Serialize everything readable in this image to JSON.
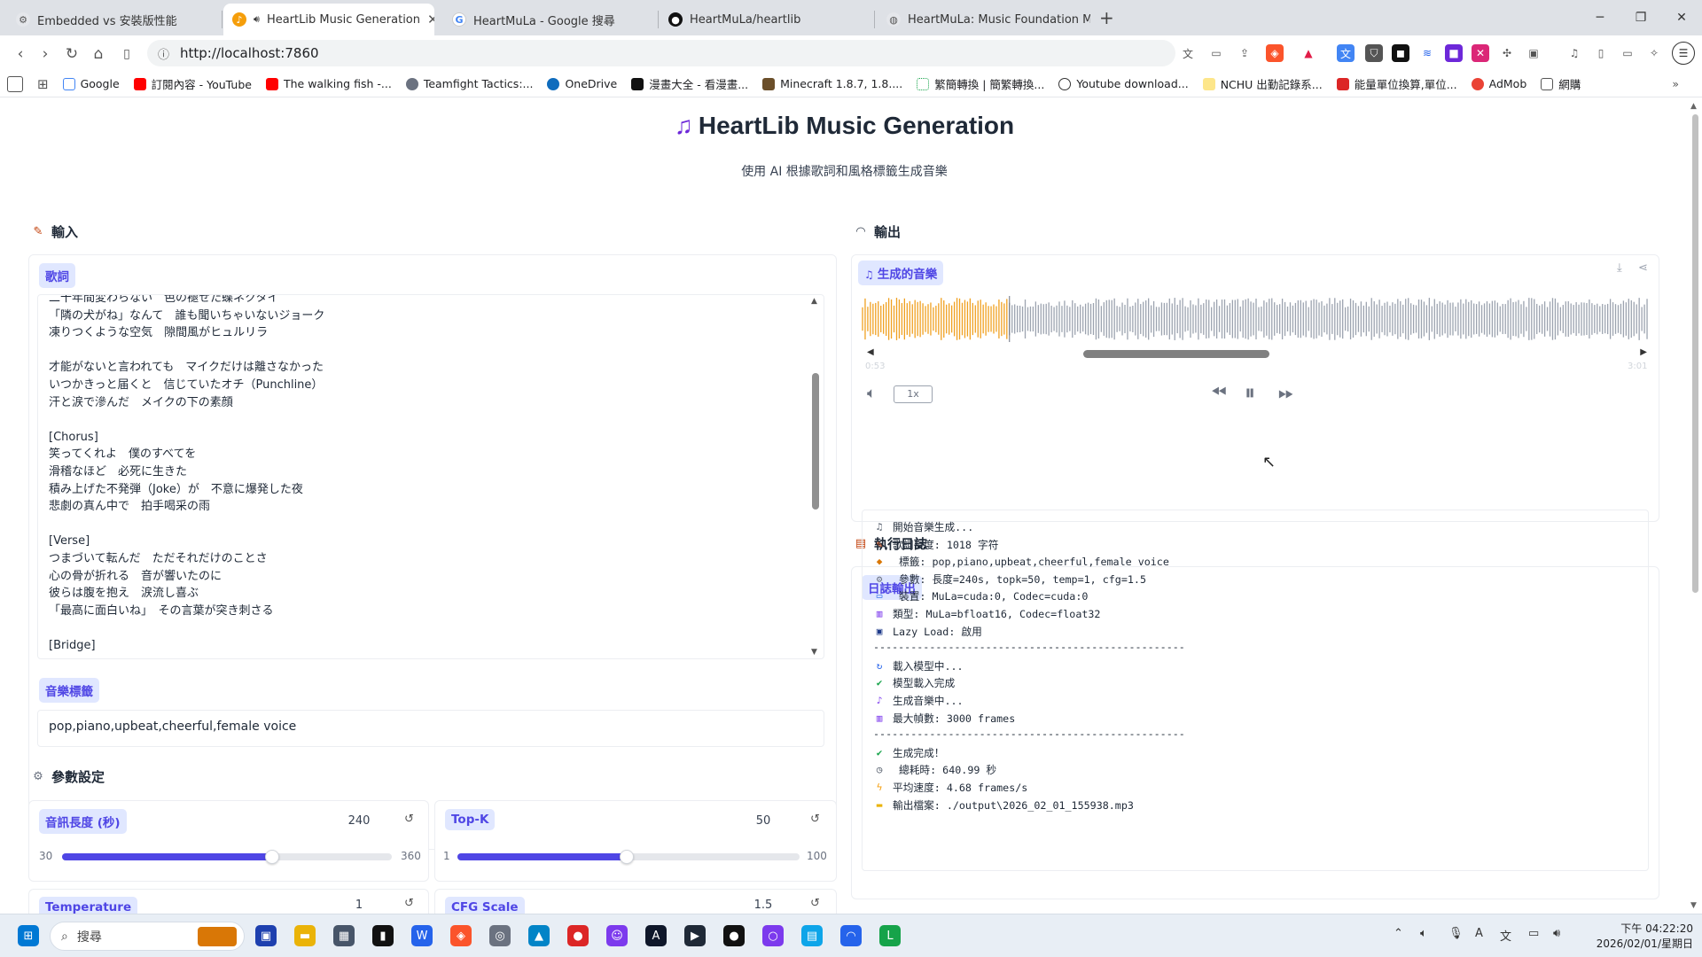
{
  "browser": {
    "tabs": [
      {
        "label": "Embedded vs 安裝版性能",
        "active": false
      },
      {
        "label": "HeartLib Music Generation",
        "active": true
      },
      {
        "label": "HeartMuLa - Google 搜尋",
        "active": false
      },
      {
        "label": "HeartMuLa/heartlib",
        "active": false
      },
      {
        "label": "HeartMuLa: Music Foundation Mo",
        "active": false
      }
    ],
    "url": "http://localhost:7860",
    "bookmarks": [
      "Google",
      "訂閱內容 - YouTube",
      "The walking fish -...",
      "Teamfight Tactics:...",
      "OneDrive",
      "漫畫大全 - 看漫畫...",
      "Minecraft 1.8.7, 1.8....",
      "繁簡轉換 | 簡繁轉換...",
      "Youtube download...",
      "NCHU 出勤記錄系...",
      "能量單位換算,單位...",
      "AdMob",
      "網購"
    ]
  },
  "app": {
    "title": "HeartLib Music Generation",
    "subtitle": "使用 AI 根據歌詞和風格標籤生成音樂"
  },
  "input": {
    "section_label": "輸入",
    "lyrics_label": "歌詞",
    "lyrics_lines": [
      "二十年間変わらない　色の褪せた蝶ネクタイ",
      "「隣の犬がね」なんて　誰も聞いちゃいないジョーク",
      "凍りつくような空気　隙間風がヒュルリラ",
      "",
      "才能がないと言われても　マイクだけは離さなかった",
      "いつかきっと届くと　信じていたオチ（Punchline）",
      "汗と涙で滲んだ　メイクの下の素顔",
      "",
      "[Chorus]",
      "笑ってくれよ　僕のすべてを",
      "滑稽なほど　必死に生きた",
      "積み上げた不発弾（Joke）が　不意に爆発した夜",
      "悲劇の真ん中で　拍手喝采の雨",
      "",
      "[Verse]",
      "つまづいて転んだ　ただそれだけのことさ",
      "心の骨が折れる　音が響いたのに",
      "彼らは腹を抱え　涙流し喜ぶ",
      "「最高に面白いね」　その言葉が突き刺さる",
      "",
      "[Bridge]"
    ],
    "tags_label": "音樂標籤",
    "tags_value": "pop,piano,upbeat,cheerful,female voice"
  },
  "params": {
    "section_label": "參數設定",
    "duration": {
      "label": "音訊長度 (秒)",
      "value": "240",
      "min": "30",
      "max": "360",
      "fraction": 0.636
    },
    "topk": {
      "label": "Top-K",
      "value": "50",
      "min": "1",
      "max": "100",
      "fraction": 0.495
    },
    "temperature": {
      "label": "Temperature",
      "value": "1"
    },
    "cfg": {
      "label": "CFG Scale",
      "value": "1.5"
    },
    "reset_glyph": "↺"
  },
  "output": {
    "section_label": "輸出",
    "audio_label": "生成的音樂",
    "speed": "1x",
    "time_start": "0:53",
    "time_end": "3:01",
    "progress": 0.185
  },
  "logs": {
    "section_label": "執行日誌",
    "chip_label": "日誌輸出",
    "lines": [
      {
        "icon": "music-icon",
        "glyph": "♫",
        "color": "#4b5563",
        "text": "開始音樂生成..."
      },
      {
        "icon": "memo-icon",
        "glyph": "✎",
        "color": "#c2410c",
        "text": "歌詞長度: 1018 字符"
      },
      {
        "icon": "tag-icon",
        "glyph": "◆",
        "color": "#d97706",
        "text": " 標籤: pop,piano,upbeat,cheerful,female voice"
      },
      {
        "icon": "gear-icon",
        "glyph": "⚙",
        "color": "#6b7280",
        "text": " 參數: 長度=240s, topk=50, temp=1, cfg=1.5"
      },
      {
        "icon": "monitor-icon",
        "glyph": "▭",
        "color": "#2563eb",
        "text": " 裝置: MuLa=cuda:0, Codec=cuda:0"
      },
      {
        "icon": "chart-icon",
        "glyph": "▥",
        "color": "#7c3aed",
        "text": "類型: MuLa=bfloat16, Codec=float32"
      },
      {
        "icon": "floppy-icon",
        "glyph": "▣",
        "color": "#1e3a8a",
        "text": "Lazy Load: 啟用"
      },
      {
        "icon": "divider",
        "glyph": "",
        "color": "#000",
        "text": "--------------------------------------------------"
      },
      {
        "icon": "refresh-icon",
        "glyph": "↻",
        "color": "#2563eb",
        "text": "載入模型中..."
      },
      {
        "icon": "check-icon",
        "glyph": "✔",
        "color": "#16a34a",
        "text": "模型載入完成"
      },
      {
        "icon": "dancer-icon",
        "glyph": "♪",
        "color": "#7c3aed",
        "text": "生成音樂中..."
      },
      {
        "icon": "chart-icon",
        "glyph": "▥",
        "color": "#7c3aed",
        "text": "最大幀數: 3000 frames"
      },
      {
        "icon": "divider",
        "glyph": "",
        "color": "#000",
        "text": "--------------------------------------------------"
      },
      {
        "icon": "check-icon",
        "glyph": "✔",
        "color": "#16a34a",
        "text": "生成完成！"
      },
      {
        "icon": "stopwatch-icon",
        "glyph": "◷",
        "color": "#4b5563",
        "text": " 總耗時: 640.99 秒"
      },
      {
        "icon": "lightning-icon",
        "glyph": "ϟ",
        "color": "#f59e0b",
        "text": "平均速度: 4.68 frames/s"
      },
      {
        "icon": "folder-icon",
        "glyph": "▬",
        "color": "#eab308",
        "text": "輸出檔案: ./output\\2026_02_01_155938.mp3"
      }
    ]
  },
  "taskbar": {
    "search_placeholder": "搜尋",
    "time": "下午 04:22:20",
    "date": "2026/02/01/星期日"
  },
  "colors": {
    "accent": "#4f46e5",
    "chip_bg": "#e0e7ff",
    "wave_played": "#f0a020",
    "wave_unplayed": "#9ca3af"
  }
}
